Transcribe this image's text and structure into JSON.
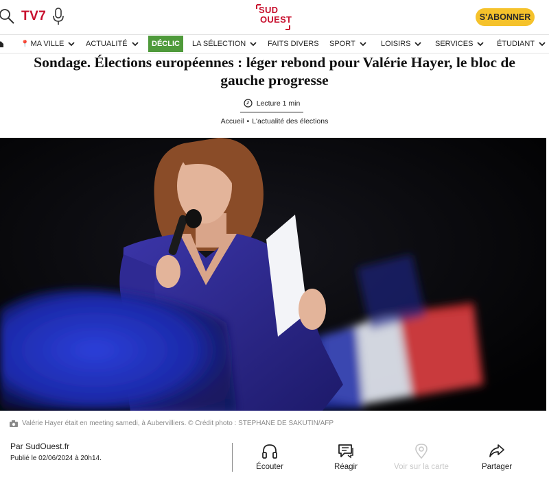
{
  "header": {
    "tv_label": "TV7",
    "logo_line1": "SUD",
    "logo_line2": "OUEST",
    "subscribe_label": "S'ABONNER"
  },
  "nav": {
    "items": [
      {
        "label": "MA VILLE"
      },
      {
        "label": "ACTUALITÉ"
      },
      {
        "label": "DÉCLIC"
      },
      {
        "label": "LA SÉLECTION"
      },
      {
        "label": "FAITS DIVERS"
      },
      {
        "label": "SPORT"
      },
      {
        "label": "LOISIRS"
      },
      {
        "label": "SERVICES"
      },
      {
        "label": "ÉTUDIANT"
      }
    ]
  },
  "article": {
    "title": "Sondage. Élections européennes : léger rebond pour Valérie Hayer, le bloc de gauche progresse",
    "reading_time": "Lecture 1 min",
    "breadcrumb": [
      "Accueil",
      "L'actualité des élections"
    ],
    "caption": "Valérie Hayer était en meeting samedi, à Aubervilliers. © Crédit photo : STEPHANE DE SAKUTIN/AFP",
    "author": "Par SudOuest.fr",
    "published": "Publié le 02/06/2024 à 20h14."
  },
  "actions": [
    {
      "label": "Écouter",
      "icon": "headphones-icon"
    },
    {
      "label": "Réagir",
      "icon": "comment-icon"
    },
    {
      "label": "Voir sur la carte",
      "icon": "map-pin-icon"
    },
    {
      "label": "Partager",
      "icon": "share-icon"
    }
  ],
  "colors": {
    "brand_red": "#c8102e",
    "subscribe_yellow": "#f5c22b",
    "declic_green": "#4f9a3b"
  }
}
